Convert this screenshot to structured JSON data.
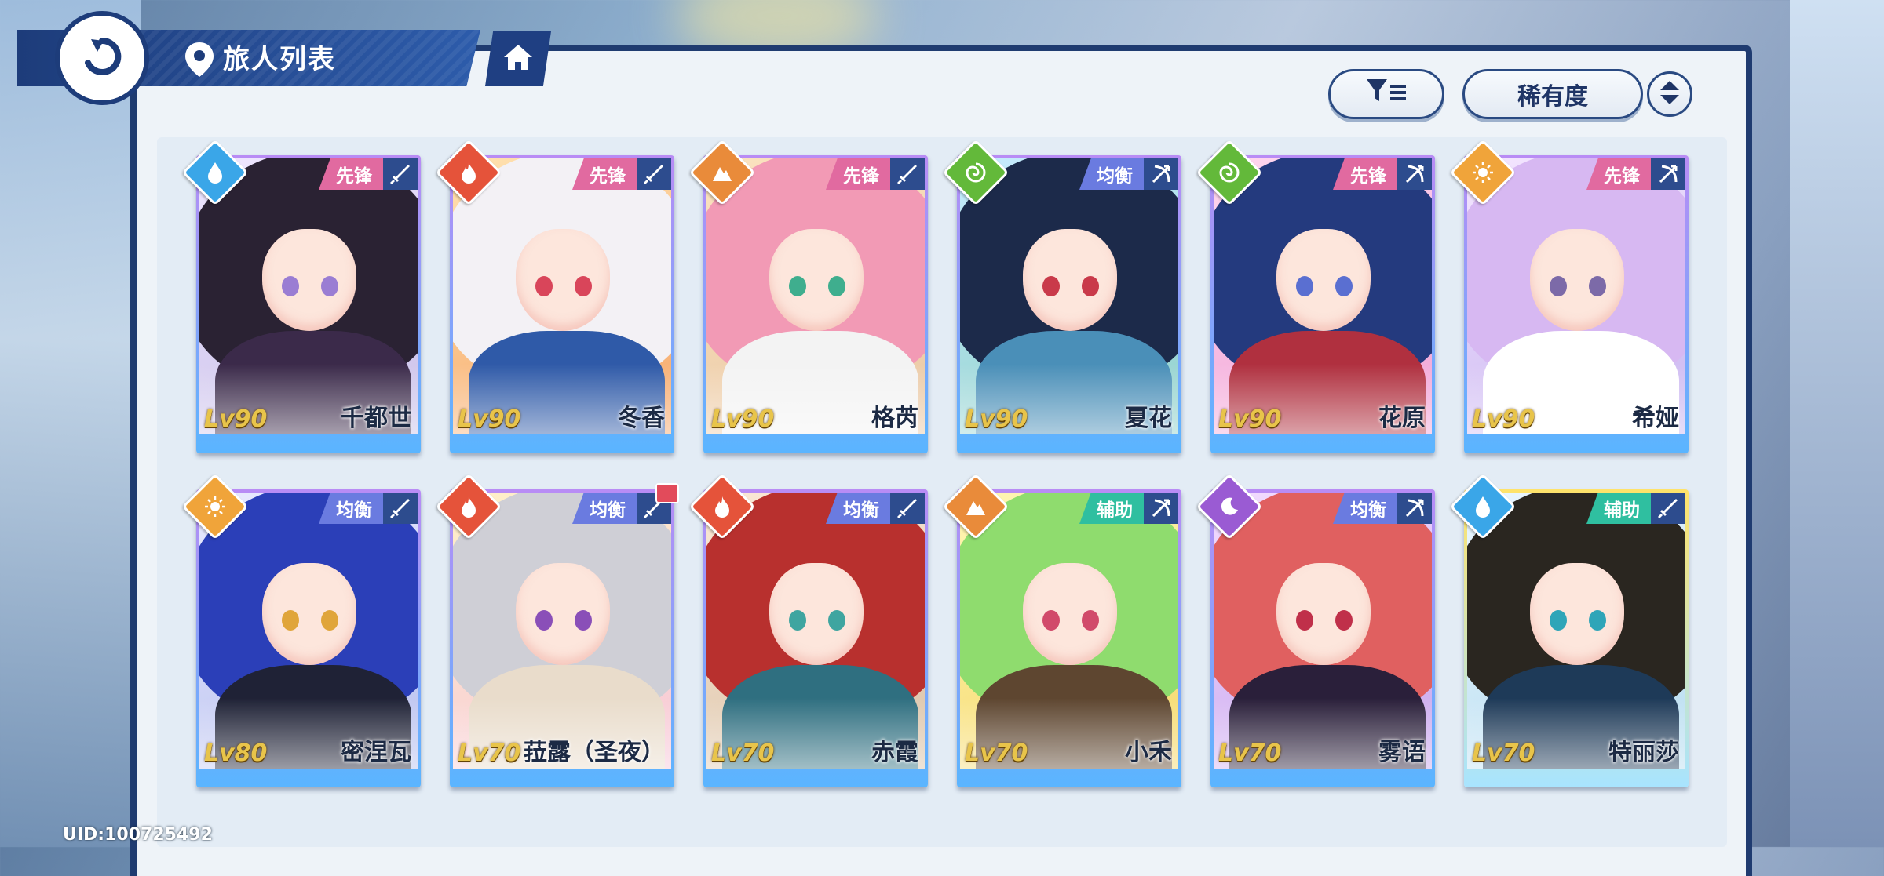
{
  "header": {
    "title": "旅人列表"
  },
  "toolbar": {
    "sort_label": "稀有度"
  },
  "footer": {
    "uid": "UID:100725492"
  },
  "colors": {
    "navy": "#1d3c7a",
    "role_vanguard": "#e16aa0",
    "role_balance": "#6a7be0",
    "role_support": "#2fbfa0",
    "elem_water": "#3aa6e8",
    "elem_fire": "#e5533a",
    "elem_earth": "#e98b3a",
    "elem_wind": "#63b93a",
    "elem_light": "#f0a43a",
    "elem_dark": "#9a5bd3"
  },
  "cards": [
    {
      "level": "Lv90",
      "name": "千都世",
      "role": "先锋",
      "element": "water-icon",
      "weapon": "sword-icon"
    },
    {
      "level": "Lv90",
      "name": "冬香",
      "role": "先锋",
      "element": "fire-icon",
      "weapon": "sword-icon"
    },
    {
      "level": "Lv90",
      "name": "格芮",
      "role": "先锋",
      "element": "earth-icon",
      "weapon": "sword-icon"
    },
    {
      "level": "Lv90",
      "name": "夏花",
      "role": "均衡",
      "element": "wind-icon",
      "weapon": "bow-icon"
    },
    {
      "level": "Lv90",
      "name": "花原",
      "role": "先锋",
      "element": "wind-icon",
      "weapon": "bow-icon"
    },
    {
      "level": "Lv90",
      "name": "希娅",
      "role": "先锋",
      "element": "light-icon",
      "weapon": "bow-icon"
    },
    {
      "level": "Lv80",
      "name": "密涅瓦",
      "role": "均衡",
      "element": "light-icon",
      "weapon": "sword-icon"
    },
    {
      "level": "Lv70",
      "name": "菈露（圣夜）",
      "role": "均衡",
      "element": "fire-icon",
      "weapon": "sword-icon"
    },
    {
      "level": "Lv70",
      "name": "赤霞",
      "role": "均衡",
      "element": "fire-icon",
      "weapon": "sword-icon"
    },
    {
      "level": "Lv70",
      "name": "小禾",
      "role": "辅助",
      "element": "earth-icon",
      "weapon": "bow-icon"
    },
    {
      "level": "Lv70",
      "name": "雾语",
      "role": "均衡",
      "element": "dark-icon",
      "weapon": "bow-icon"
    },
    {
      "level": "Lv70",
      "name": "特丽莎",
      "role": "辅助",
      "element": "water-icon",
      "weapon": "sword-icon"
    }
  ]
}
